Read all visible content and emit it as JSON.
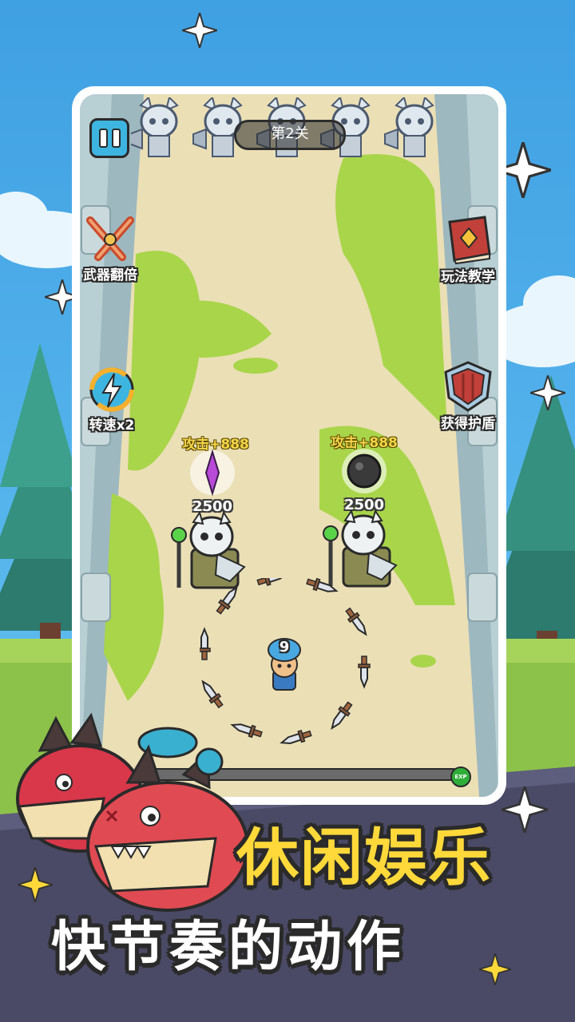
{
  "hud": {
    "level_label": "第2关",
    "weapon_double_label": "武器翻倍",
    "speed_label": "转速x2",
    "tutorial_label": "玩法教学",
    "shield_label": "获得护盾"
  },
  "enemies": [
    {
      "attack_label": "攻击+888",
      "hp": "2500",
      "drop": "purple-crystal-icon"
    },
    {
      "attack_label": "攻击+888",
      "hp": "2500",
      "drop": "black-orb-icon"
    }
  ],
  "player": {
    "level": "9"
  },
  "exp_bar": {
    "label": "EXP",
    "progress": 0.0
  },
  "promo": {
    "headline": "休闲娱乐",
    "subline": "快节奏的动作"
  },
  "colors": {
    "sky": "#3fa6e6",
    "path": "#ebdfb6",
    "slime": "#a9d54a",
    "banner_yellow": "#ffd93a",
    "ground_bottom": "#4a4a66"
  }
}
